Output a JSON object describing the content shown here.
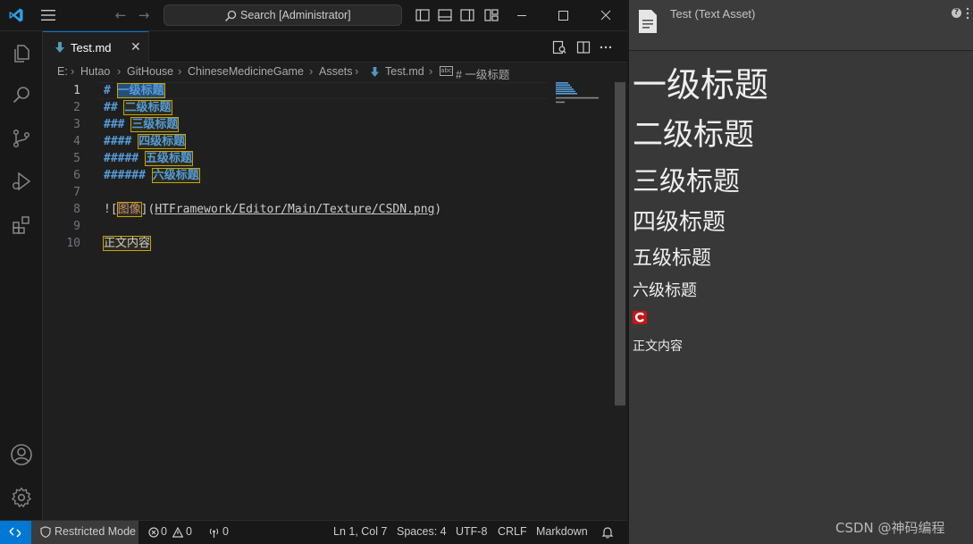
{
  "titlebar": {
    "search_label": "Search [Administrator]"
  },
  "tab": {
    "filename": "Test.md",
    "close_glyph": "✕"
  },
  "breadcrumb": {
    "items": [
      "E:",
      "Hutao",
      "GitHouse",
      "ChineseMedicineGame",
      "Assets",
      "Test.md",
      "# 一级标题"
    ],
    "symbol_badge": "abc"
  },
  "editor": {
    "lines": [
      {
        "num": "1",
        "prefix": "# ",
        "text": "一级标题"
      },
      {
        "num": "2",
        "prefix": "## ",
        "text": "二级标题"
      },
      {
        "num": "3",
        "prefix": "### ",
        "text": "三级标题"
      },
      {
        "num": "4",
        "prefix": "#### ",
        "text": "四级标题"
      },
      {
        "num": "5",
        "prefix": "##### ",
        "text": "五级标题"
      },
      {
        "num": "6",
        "prefix": "###### ",
        "text": "六级标题"
      },
      {
        "num": "7"
      },
      {
        "num": "8",
        "img_open": "![",
        "img_alt": "图像",
        "img_mid": "](",
        "img_path": "HTFramework/Editor/Main/Texture/CSDN.png",
        "img_close": ")"
      },
      {
        "num": "9"
      },
      {
        "num": "10",
        "text": "正文内容"
      }
    ]
  },
  "statusbar": {
    "restricted": "Restricted Mode",
    "errors": "0",
    "warnings": "0",
    "ports": "0",
    "position": "Ln 1, Col 7",
    "spaces": "Spaces: 4",
    "encoding": "UTF-8",
    "eol": "CRLF",
    "language": "Markdown"
  },
  "inspector": {
    "title": "Test (Text Asset)",
    "help": "?",
    "preview": {
      "h1": "一级标题",
      "h2": "二级标题",
      "h3": "三级标题",
      "h4": "四级标题",
      "h5": "五级标题",
      "h6": "六级标题",
      "body": "正文内容"
    }
  },
  "watermark": "CSDN @神码编程",
  "colors": {
    "accent": "#0078d4",
    "heading": "#569cd6",
    "highlight_border": "#c9a400"
  }
}
